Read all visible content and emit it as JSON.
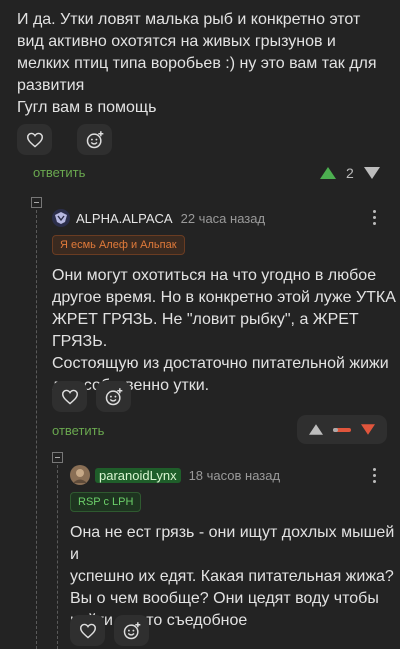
{
  "comment1": {
    "lines": [
      "И да. Утки ловят малька рыб и конкретно этот",
      "вид активно охотятся на живых грызунов и",
      "мелких птиц типа воробьев :) ну это вам так для",
      "развития",
      "Гугл вам в помощь"
    ],
    "reply_label": "ответить",
    "rating": "2"
  },
  "comment2": {
    "author": "ALPHA.ALPACA",
    "time": "22 часа назад",
    "badge": "Я есмь Алеф и Альпак",
    "lines": [
      "Они могут охотиться на что угодно в любое",
      "другое время. Но в конкретно этой луже УТКА",
      "ЖРЕТ ГРЯЗЬ. Не \"ловит рыбку\", а ЖРЕТ ГРЯЗЬ.",
      "Состоящую из достаточно питательной жижи",
      "для собственно утки."
    ],
    "reply_label": "ответить"
  },
  "comment3": {
    "author": "paranoidLynx",
    "time": "18 часов назад",
    "badge": "RSP с LPH",
    "lines": [
      "Она не ест грязь - они ищут дохлых мышей и",
      "успешно их едят. Какая питательная жижа?",
      "Вы о чем вообще? Они цедят воду чтобы",
      "найти что то съедобное"
    ]
  },
  "colors": {
    "background": "#232323",
    "reply_green": "#6aa84f",
    "upvote": "#4caf50",
    "downvote": "#e0553c",
    "badge_orange": "#e07a3a",
    "badge_green": "#6ccf6a"
  }
}
